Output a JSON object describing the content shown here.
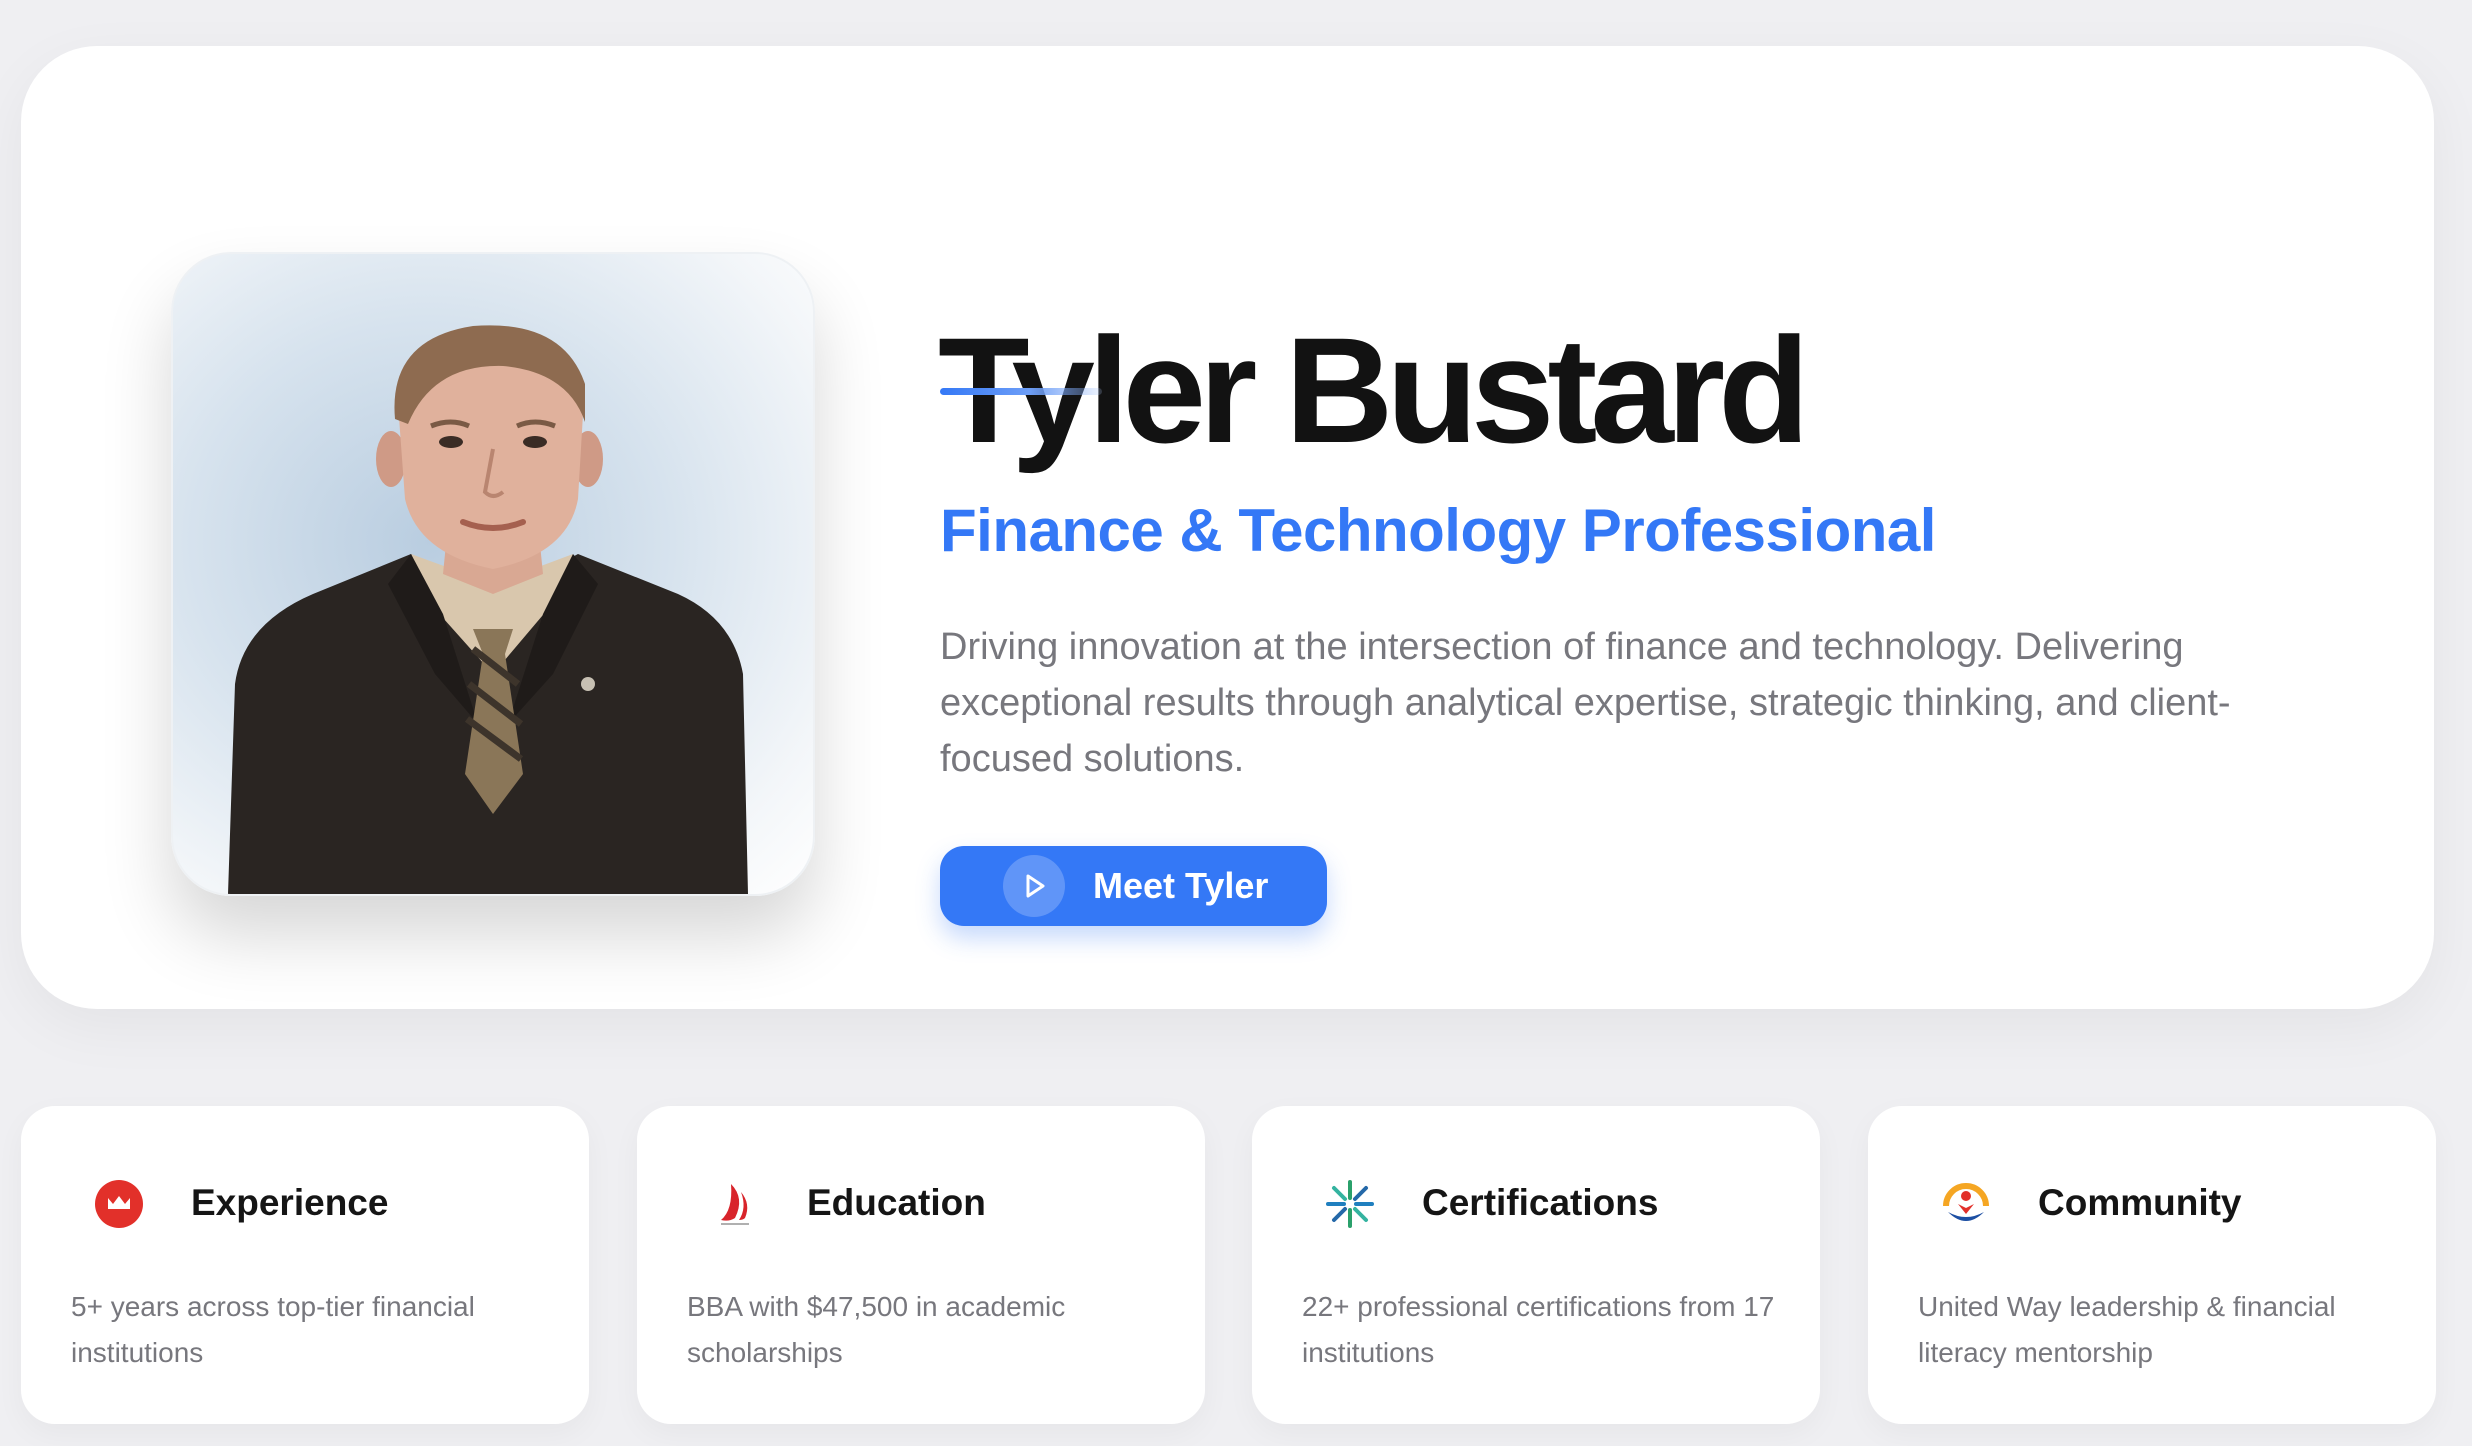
{
  "profile": {
    "name": "Tyler Bustard",
    "title": "Finance & Technology Professional",
    "bio": "Driving innovation at the intersection of finance and technology. Delivering exceptional results through analytical expertise, strategic thinking, and client-focused solutions.",
    "cta_label": "Meet Tyler"
  },
  "colors": {
    "accent": "#3478f6",
    "background": "#efeff2",
    "card": "#ffffff",
    "heading": "#121212",
    "body_text": "#77777d"
  },
  "highlights": [
    {
      "icon": "bmo-bank-logo-icon",
      "title": "Experience",
      "description": "5+ years across top-tier financial institutions"
    },
    {
      "icon": "university-sail-logo-icon",
      "title": "Education",
      "description": "BBA with $47,500 in academic scholarships"
    },
    {
      "icon": "starburst-logo-icon",
      "title": "Certifications",
      "description": "22+ professional certifications from 17 institutions"
    },
    {
      "icon": "united-way-logo-icon",
      "title": "Community",
      "description": "United Way leadership & financial literacy mentorship"
    }
  ]
}
